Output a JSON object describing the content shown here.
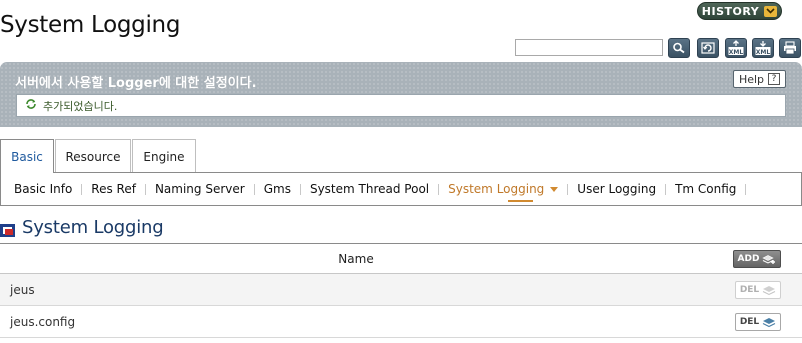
{
  "header": {
    "title": "System Logging",
    "history_label": "HISTORY",
    "search": {
      "value": "",
      "placeholder": ""
    },
    "toolbar_icons": [
      "search-icon",
      "refresh-icon",
      "export-xml-icon",
      "import-xml-icon",
      "print-icon"
    ],
    "toolbar_xml_label": "XML"
  },
  "banner": {
    "description": "서버에서 사용할 Logger에 대한 설정이다.",
    "help_label": "Help",
    "help_glyph": "?",
    "message": "추가되었습니다."
  },
  "tabs": [
    {
      "label": "Basic",
      "active": true
    },
    {
      "label": "Resource",
      "active": false
    },
    {
      "label": "Engine",
      "active": false
    }
  ],
  "subnav": [
    {
      "label": "Basic Info",
      "active": false
    },
    {
      "label": "Res Ref",
      "active": false
    },
    {
      "label": "Naming Server",
      "active": false
    },
    {
      "label": "Gms",
      "active": false
    },
    {
      "label": "System Thread Pool",
      "active": false
    },
    {
      "label": "System Logging",
      "active": true
    },
    {
      "label": "User Logging",
      "active": false
    },
    {
      "label": "Tm Config",
      "active": false
    }
  ],
  "section": {
    "title": "System Logging",
    "table": {
      "column_header": "Name",
      "add_label": "ADD",
      "rows": [
        {
          "name": "jeus",
          "del_label": "DEL",
          "enabled": false
        },
        {
          "name": "jeus.config",
          "del_label": "DEL",
          "enabled": true
        }
      ]
    }
  },
  "colors": {
    "accent": "#c0792a",
    "title_blue": "#1a3a66",
    "banner_gray": "#a9b2b9"
  }
}
